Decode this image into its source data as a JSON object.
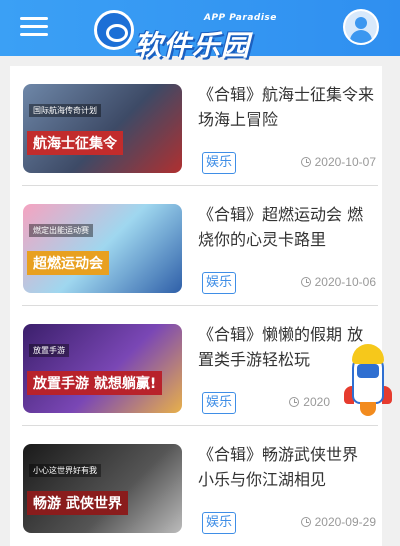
{
  "header": {
    "logo_sub": "APP Paradise",
    "logo_main": "软件乐园"
  },
  "articles": [
    {
      "title": "《合辑》航海士征集令来场海上冒险",
      "thumb_caption": "航海士征集令",
      "thumb_tagline": "国际航海传奇计划",
      "tag": "娱乐",
      "date": "2020-10-07"
    },
    {
      "title": "《合辑》超燃运动会 燃烧你的心灵卡路里",
      "thumb_caption": "超燃运动会",
      "thumb_tagline": "燃定出能运动赛",
      "tag": "娱乐",
      "date": "2020-10-06"
    },
    {
      "title": "《合辑》懒懒的假期 放置类手游轻松玩",
      "thumb_caption": "放置手游 就想躺赢!",
      "thumb_tagline": "放置手游",
      "tag": "娱乐",
      "date": "2020"
    },
    {
      "title": "《合辑》畅游武侠世界 小乐与你江湖相见",
      "thumb_caption": "畅游 武侠世界",
      "thumb_tagline": "小心这世界好有我",
      "tag": "娱乐",
      "date": "2020-09-29"
    }
  ],
  "colors": {
    "header_blue": "#3ba0f5",
    "tag_blue": "#3f8ee6",
    "thumb_bg": [
      "#5b6b8a",
      "#e87da0",
      "#6b3f9e",
      "#2a2a2a"
    ]
  }
}
